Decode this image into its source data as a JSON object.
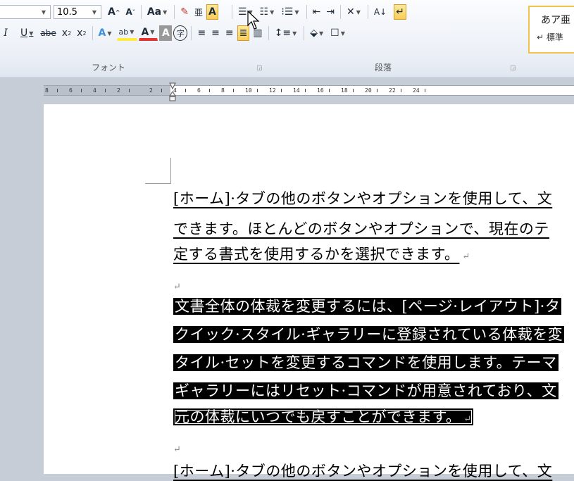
{
  "ribbon": {
    "font_size": "10.5",
    "grow_font": "A",
    "shrink_font": "A",
    "change_case": "Aa",
    "phonetic_guide": "亜",
    "enclose_char": "A",
    "char_border": "A",
    "italic": "I",
    "underline": "U",
    "strike": "abe",
    "subscript": "x",
    "superscript": "x",
    "text_effects": "A",
    "highlight": "ab",
    "font_color": "A",
    "char_shading": "A",
    "enclosed_char": "字",
    "sort": "A↓",
    "font_group_label": "フォント",
    "paragraph_group_label": "段落",
    "styles": {
      "sample": "あア亜",
      "name": "↵ 標準"
    }
  },
  "ruler": {
    "ticks": [
      "8",
      "6",
      "4",
      "2",
      "2",
      "4",
      "6",
      "8",
      "10",
      "12",
      "14",
      "16",
      "18",
      "20",
      "22",
      "24"
    ]
  },
  "document": {
    "para1": [
      "[ホーム]·タブの他のボタンやオプションを使用して、文",
      "できます。ほとんどのボタンやオプションで、現在のテ",
      "定する書式を使用するかを選択できます。"
    ],
    "para2": [
      "文書全体の体裁を変更するには、[ページ·レイアウト]·タ",
      "クイック·スタイル·ギャラリーに登録されている体裁を変",
      "タイル·セットを変更するコマンドを使用します。テーマ",
      "ギャラリーにはリセット·コマンドが用意されており、文",
      "元の体裁にいつでも戻すことができます。"
    ],
    "para3": [
      "[ホーム]·タブの他のボタンやオプションを使用して、文"
    ],
    "mark": "↵"
  }
}
